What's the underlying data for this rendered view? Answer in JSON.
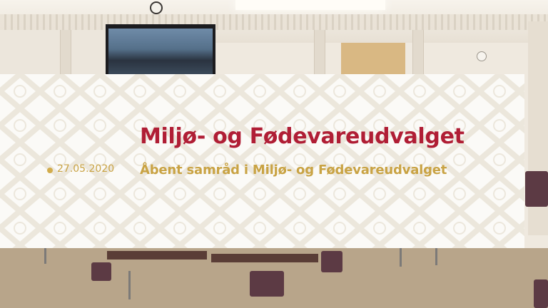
{
  "banner": {
    "title": "Miljø- og Fødevareudvalget",
    "subtitle": "Åbent samråd i Miljø- og Fødevareudvalget",
    "date": "27.05.2020"
  },
  "colors": {
    "title": "#b01e35",
    "accent": "#c9a344",
    "banner_background": "#fbfaf7",
    "pattern": "#ece7dc"
  },
  "icons": {
    "date_bullet": "bullet-dot-icon"
  }
}
